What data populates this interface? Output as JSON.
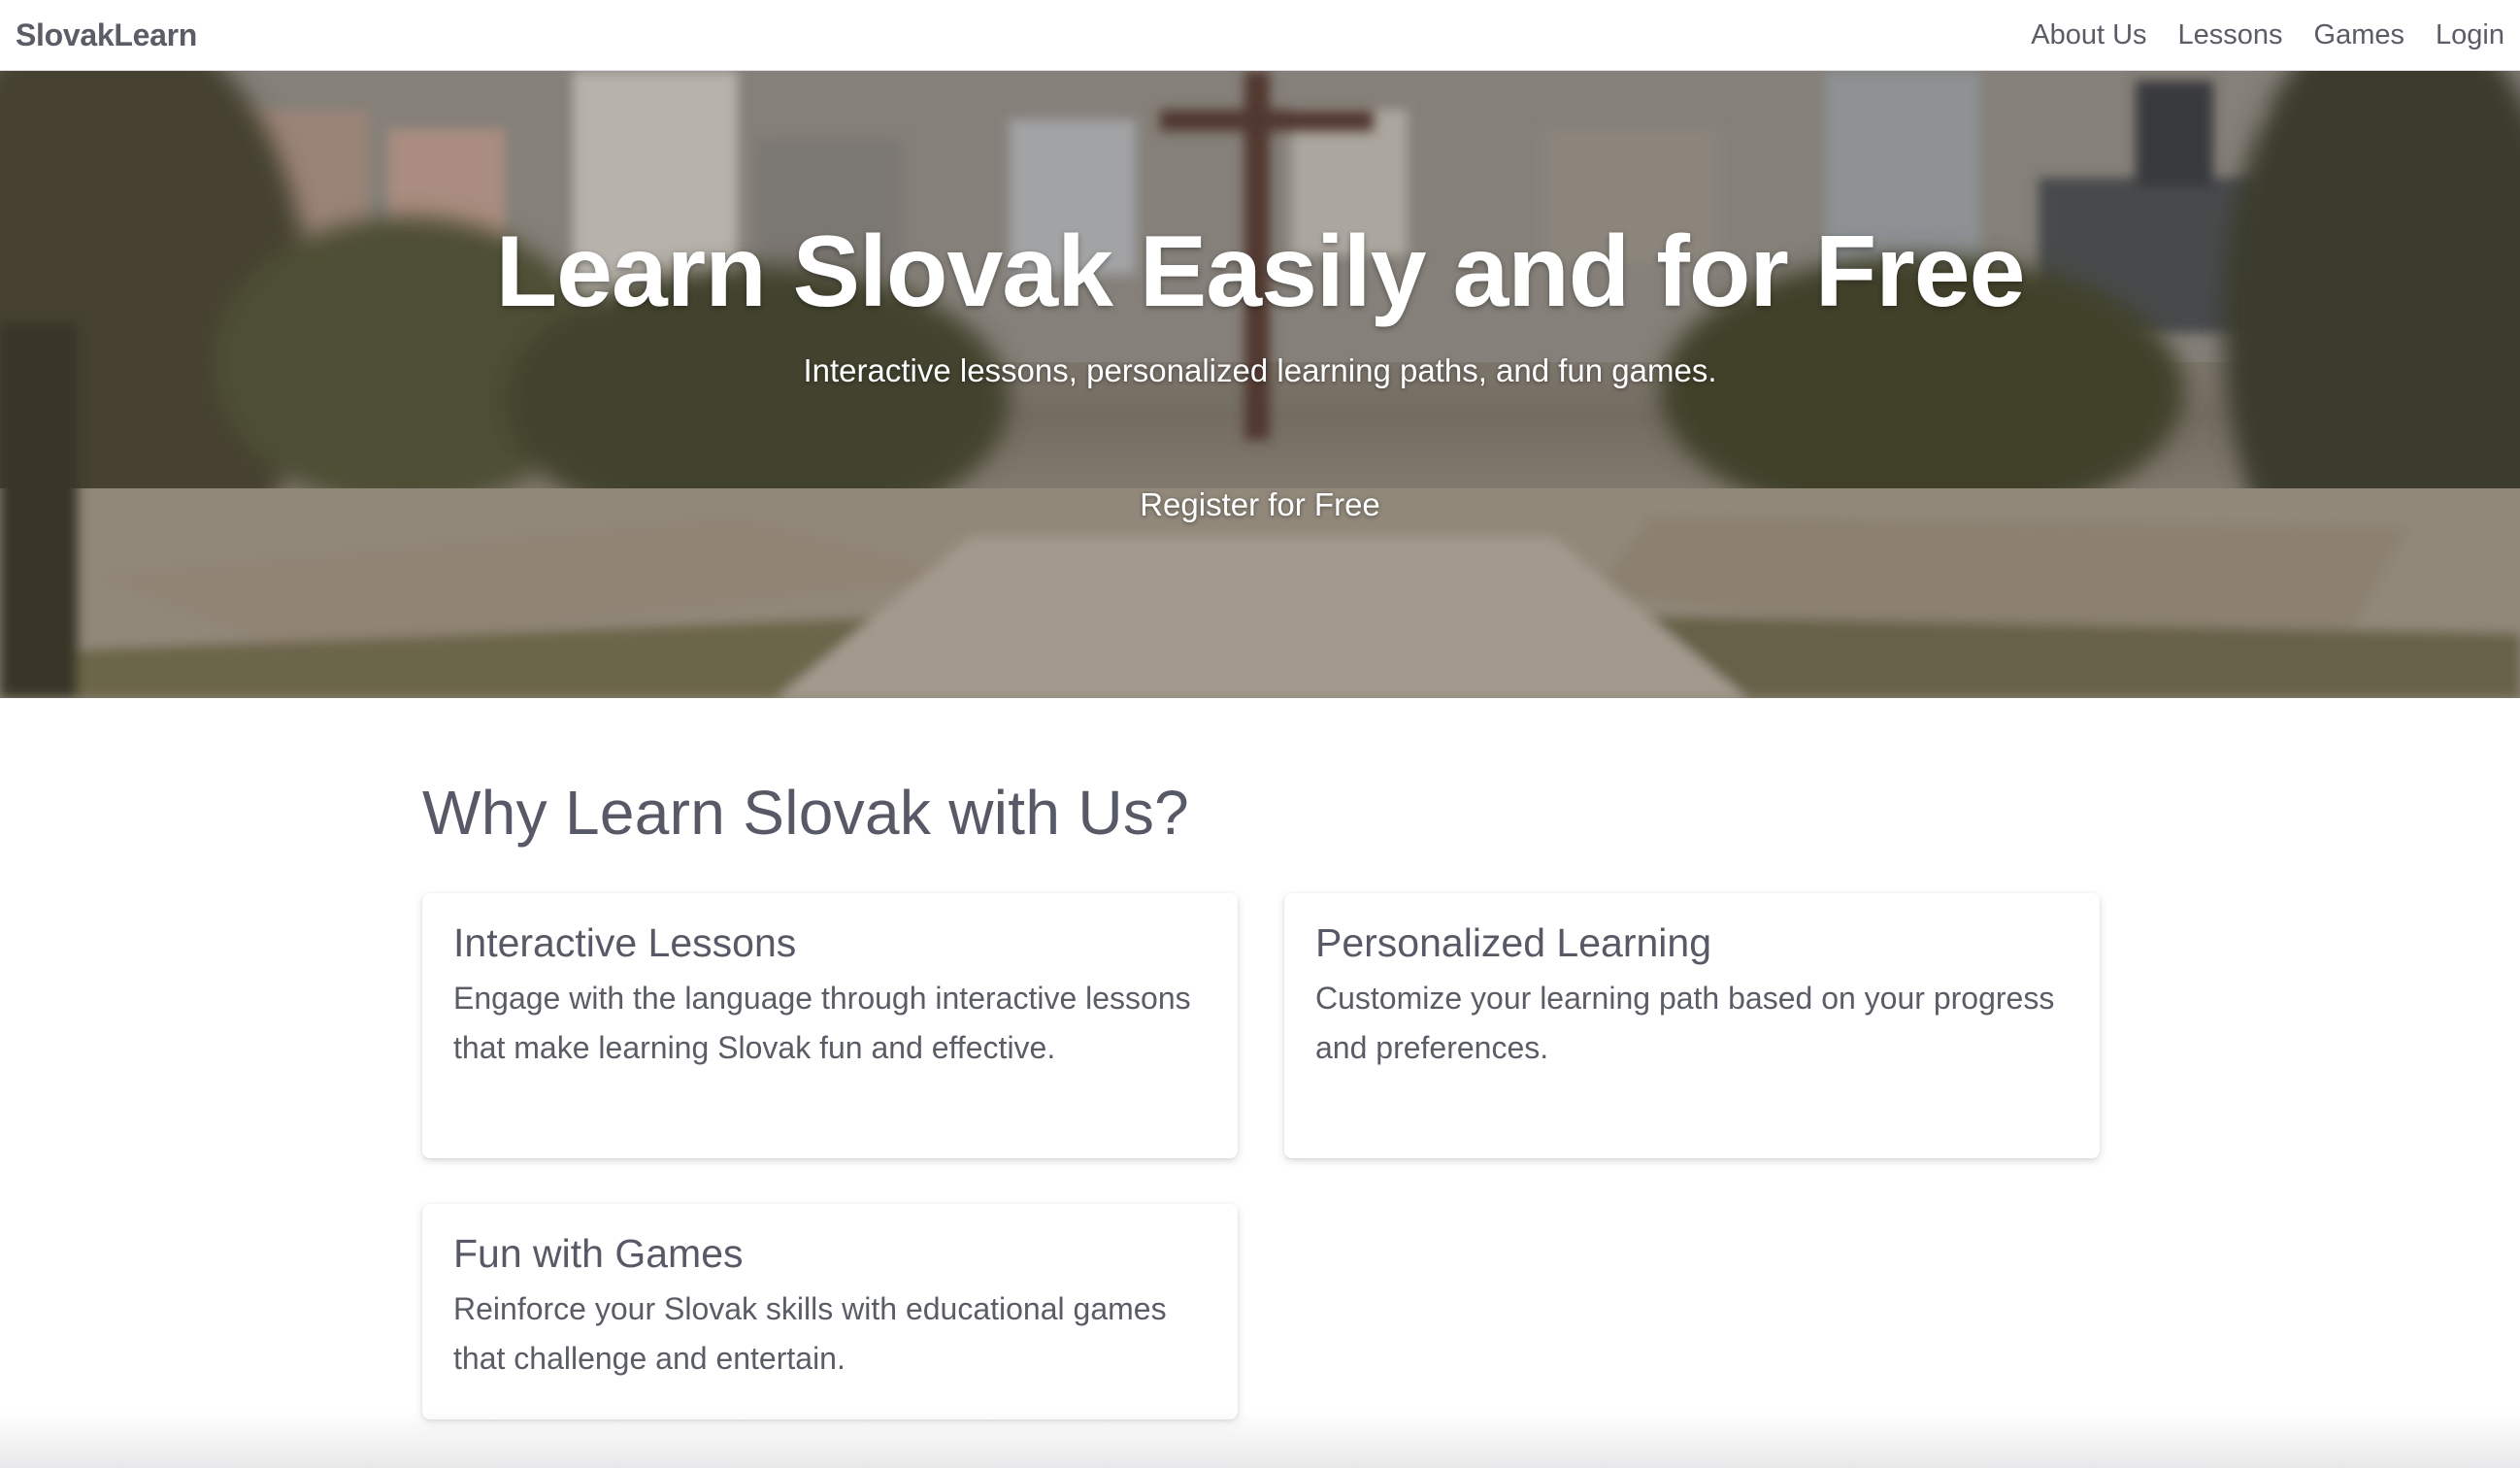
{
  "navbar": {
    "brand": "SlovakLearn",
    "links": [
      "About Us",
      "Lessons",
      "Games",
      "Login"
    ]
  },
  "hero": {
    "title": "Learn Slovak Easily and for Free",
    "subtitle": "Interactive lessons, personalized learning paths, and fun games.",
    "cta_label": "Register for Free"
  },
  "features": {
    "heading": "Why Learn Slovak with Us?",
    "cards": [
      {
        "title": "Interactive Lessons",
        "text": "Engage with the language through interactive lessons that make learning Slovak fun and effective."
      },
      {
        "title": "Personalized Learning",
        "text": "Customize your learning path based on your progress and preferences."
      },
      {
        "title": "Fun with Games",
        "text": "Reinforce your Slovak skills with educational games that challenge and entertain."
      }
    ]
  },
  "colors": {
    "text": "#5a5c66",
    "hero_text": "#ffffff",
    "background": "#ffffff"
  }
}
